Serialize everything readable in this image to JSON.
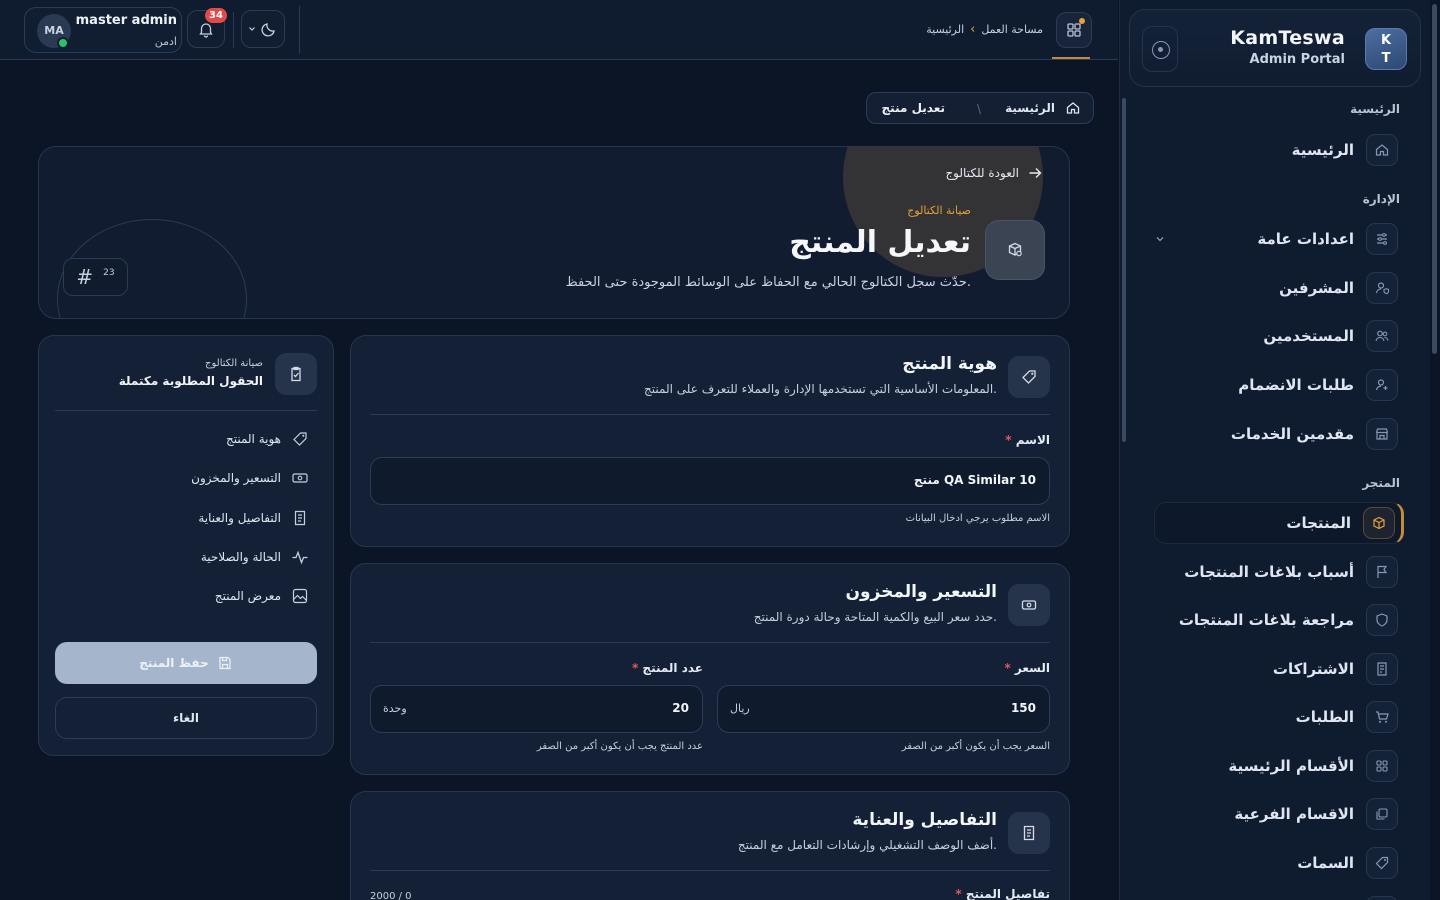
{
  "brand": {
    "logo_top": "K",
    "logo_bottom": "T",
    "name": "KamTeswa",
    "subtitle": "Admin Portal"
  },
  "sidebar": {
    "sections": [
      {
        "title": "الرئيسية",
        "items": [
          {
            "label": "الرئيسية",
            "icon": "home-icon"
          }
        ]
      },
      {
        "title": "الإدارة",
        "items": [
          {
            "label": "اعدادات عامة",
            "icon": "sliders-icon",
            "expandable": true
          },
          {
            "label": "المشرفين",
            "icon": "user-shield-icon"
          },
          {
            "label": "المستخدمين",
            "icon": "users-icon"
          },
          {
            "label": "طلبات الانضمام",
            "icon": "user-plus-icon"
          },
          {
            "label": "مقدمين الخدمات",
            "icon": "store-icon"
          }
        ]
      },
      {
        "title": "المتجر",
        "items": [
          {
            "label": "المنتجات",
            "icon": "box-icon",
            "active": true
          },
          {
            "label": "أسباب بلاغات المنتجات",
            "icon": "flag-icon"
          },
          {
            "label": "مراجعة بلاغات المنتجات",
            "icon": "shield-icon"
          },
          {
            "label": "الاشتراكات",
            "icon": "receipt-icon"
          },
          {
            "label": "الطلبات",
            "icon": "cart-icon"
          },
          {
            "label": "الأقسام الرئيسية",
            "icon": "grid-icon"
          },
          {
            "label": "الاقسام الفرعية",
            "icon": "layers-icon"
          },
          {
            "label": "السمات",
            "icon": "tag-icon"
          }
        ]
      }
    ]
  },
  "topbar": {
    "breadcrumb": [
      "الرئيسية",
      "مساحة العمل"
    ],
    "user": {
      "initials": "MA",
      "name": "master admin",
      "role": "ادمن"
    },
    "notifications_count": "34"
  },
  "page_breadcrumb": {
    "home": "الرئيسية",
    "current": "تعديل منتج"
  },
  "hero": {
    "back_label": "العودة للكتالوج",
    "kicker": "صيانة الكتالوج",
    "title": "تعديل المنتج",
    "description": "حدّث سجل الكتالوج الحالي مع الحفاظ على الوسائط الموجودة حتى الحفظ.",
    "product_id": "23"
  },
  "identity_card": {
    "title": "هوية المنتج",
    "subtitle": "المعلومات الأساسية التي تستخدمها الإدارة والعملاء للتعرف على المنتج.",
    "name_label": "الاسم",
    "name_value": "منتج QA Similar 10",
    "name_hint": "الاسم مطلوب يرجي ادخال البيانات"
  },
  "pricing_card": {
    "title": "التسعير والمخزون",
    "subtitle": "حدد سعر البيع والكمية المتاحة وحالة دورة المنتج.",
    "price_label": "السعر",
    "price_value": "150",
    "price_unit": "ريال",
    "price_hint": "السعر يجب أن يكون أكبر من الصفر",
    "qty_label": "عدد المنتج",
    "qty_value": "20",
    "qty_unit": "وحدة",
    "qty_hint": "عدد المنتج يجب أن يكون أكبر من الصفر"
  },
  "details_card": {
    "title": "التفاصيل والعناية",
    "subtitle": "أضف الوصف التشغيلي وإرشادات التعامل مع المنتج.",
    "field_label": "تفاصيل المنتج",
    "char_count": "2000 / 0"
  },
  "panel": {
    "kicker": "صيانة الكتالوج",
    "title": "الحقول المطلوبة مكتملة",
    "sections": [
      {
        "label": "هوية المنتج",
        "icon": "tag-icon"
      },
      {
        "label": "التسعير والمخزون",
        "icon": "cash-icon"
      },
      {
        "label": "التفاصيل والعناية",
        "icon": "document-icon"
      },
      {
        "label": "الحالة والصلاحية",
        "icon": "activity-icon"
      },
      {
        "label": "معرض المنتج",
        "icon": "image-icon"
      }
    ],
    "save_label": "حفظ المنتج",
    "cancel_label": "الغاء"
  },
  "colors": {
    "accent": "#c7893a",
    "badge": "#e24a4a",
    "online": "#2bc26b",
    "background": "#0b1525"
  }
}
